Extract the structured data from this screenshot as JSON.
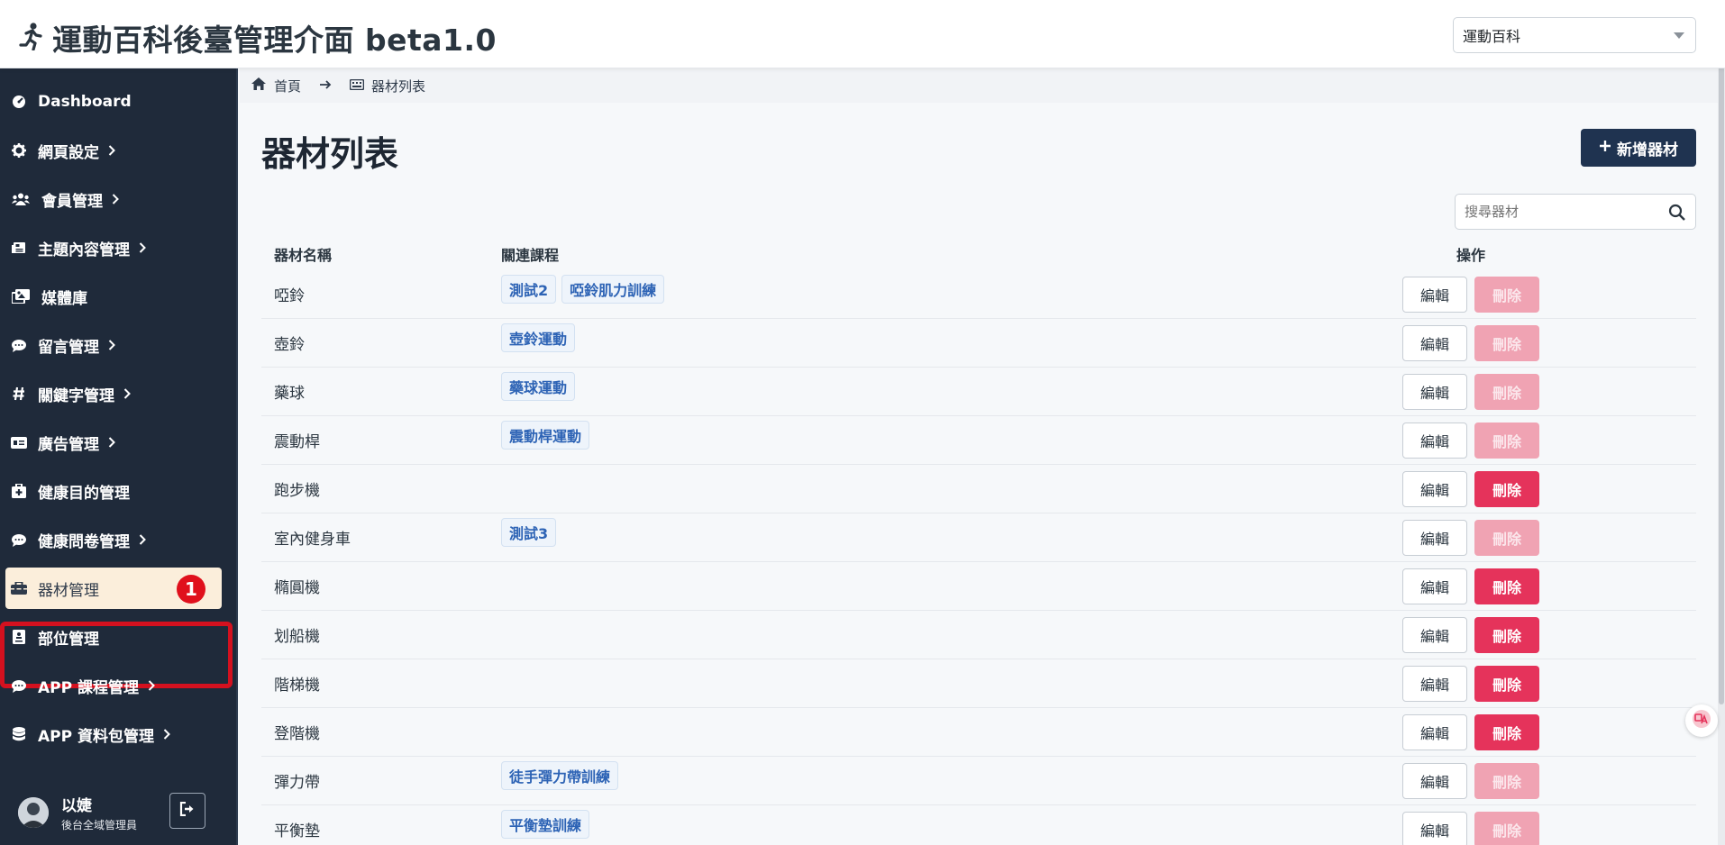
{
  "header": {
    "title": "運動百科後臺管理介面 beta1.0",
    "site_select_value": "運動百科"
  },
  "sidebar": {
    "items": [
      {
        "label": "Dashboard",
        "icon": "dashboard-icon",
        "has_children": false
      },
      {
        "label": "網頁設定",
        "icon": "gear-icon",
        "has_children": true
      },
      {
        "label": "會員管理",
        "icon": "users-icon",
        "has_children": true
      },
      {
        "label": "主題內容管理",
        "icon": "newspaper-icon",
        "has_children": true
      },
      {
        "label": "媒體庫",
        "icon": "images-icon",
        "has_children": false
      },
      {
        "label": "留言管理",
        "icon": "comment-icon",
        "has_children": true
      },
      {
        "label": "關鍵字管理",
        "icon": "hashtag-icon",
        "has_children": true
      },
      {
        "label": "廣告管理",
        "icon": "ad-icon",
        "has_children": true
      },
      {
        "label": "健康目的管理",
        "icon": "medical-kit-icon",
        "has_children": false
      },
      {
        "label": "健康問卷管理",
        "icon": "comment-icon",
        "has_children": true
      },
      {
        "label": "器材管理",
        "icon": "toolbox-icon",
        "has_children": false,
        "active": true
      },
      {
        "label": "部位管理",
        "icon": "body-part-icon",
        "has_children": false
      },
      {
        "label": "APP 課程管理",
        "icon": "comment-icon",
        "has_children": true
      },
      {
        "label": "APP 資料包管理",
        "icon": "database-icon",
        "has_children": true
      }
    ],
    "annotation_number": "1",
    "user": {
      "name": "以婕",
      "role": "後台全域管理員"
    }
  },
  "breadcrumb": {
    "home": "首頁",
    "current": "器材列表"
  },
  "main": {
    "title": "器材列表",
    "add_button": "新增器材",
    "search_placeholder": "搜尋器材",
    "columns": {
      "name": "器材名稱",
      "course": "關連課程",
      "ops": "操作"
    },
    "edit_label": "編輯",
    "delete_label": "刪除",
    "rows": [
      {
        "name": "啞鈴",
        "courses": [
          "測試2",
          "啞鈴肌力訓練"
        ],
        "delete_enabled": false
      },
      {
        "name": "壺鈴",
        "courses": [
          "壺鈴運動"
        ],
        "delete_enabled": false
      },
      {
        "name": "藥球",
        "courses": [
          "藥球運動"
        ],
        "delete_enabled": false
      },
      {
        "name": "震動桿",
        "courses": [
          "震動桿運動"
        ],
        "delete_enabled": false
      },
      {
        "name": "跑步機",
        "courses": [],
        "delete_enabled": true
      },
      {
        "name": "室內健身車",
        "courses": [
          "測試3"
        ],
        "delete_enabled": false
      },
      {
        "name": "橢圓機",
        "courses": [],
        "delete_enabled": true
      },
      {
        "name": "划船機",
        "courses": [],
        "delete_enabled": true
      },
      {
        "name": "階梯機",
        "courses": [],
        "delete_enabled": true
      },
      {
        "name": "登階機",
        "courses": [],
        "delete_enabled": true
      },
      {
        "name": "彈力帶",
        "courses": [
          "徒手彈力帶訓練"
        ],
        "delete_enabled": false
      },
      {
        "name": "平衡墊",
        "courses": [
          "平衡墊訓練"
        ],
        "delete_enabled": false
      }
    ]
  },
  "colors": {
    "sidebar_bg": "#1f2a3a",
    "active_item_bg": "#fbeedb",
    "primary_button": "#1f3350",
    "delete_enabled": "#e5335b",
    "delete_disabled": "#f0a3b3",
    "annotation_red": "#d4111f"
  }
}
